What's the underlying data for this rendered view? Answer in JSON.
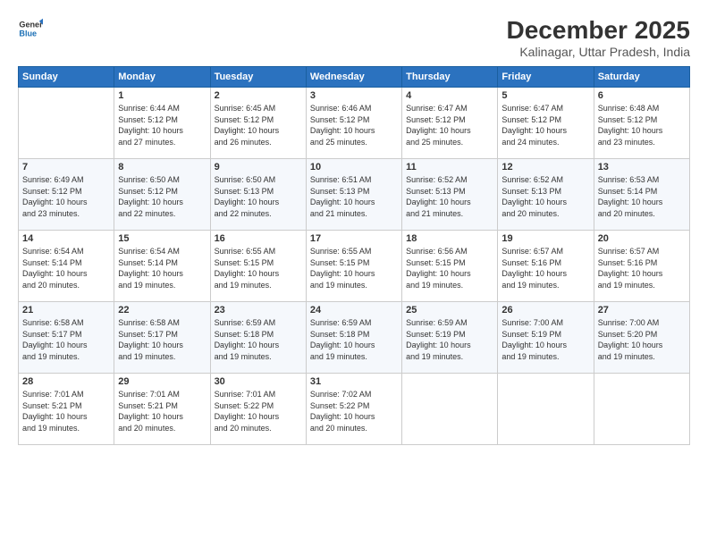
{
  "logo": {
    "line1": "General",
    "line2": "Blue"
  },
  "title": "December 2025",
  "location": "Kalinagar, Uttar Pradesh, India",
  "headers": [
    "Sunday",
    "Monday",
    "Tuesday",
    "Wednesday",
    "Thursday",
    "Friday",
    "Saturday"
  ],
  "weeks": [
    [
      {
        "day": "",
        "info": ""
      },
      {
        "day": "1",
        "info": "Sunrise: 6:44 AM\nSunset: 5:12 PM\nDaylight: 10 hours\nand 27 minutes."
      },
      {
        "day": "2",
        "info": "Sunrise: 6:45 AM\nSunset: 5:12 PM\nDaylight: 10 hours\nand 26 minutes."
      },
      {
        "day": "3",
        "info": "Sunrise: 6:46 AM\nSunset: 5:12 PM\nDaylight: 10 hours\nand 25 minutes."
      },
      {
        "day": "4",
        "info": "Sunrise: 6:47 AM\nSunset: 5:12 PM\nDaylight: 10 hours\nand 25 minutes."
      },
      {
        "day": "5",
        "info": "Sunrise: 6:47 AM\nSunset: 5:12 PM\nDaylight: 10 hours\nand 24 minutes."
      },
      {
        "day": "6",
        "info": "Sunrise: 6:48 AM\nSunset: 5:12 PM\nDaylight: 10 hours\nand 23 minutes."
      }
    ],
    [
      {
        "day": "7",
        "info": "Sunrise: 6:49 AM\nSunset: 5:12 PM\nDaylight: 10 hours\nand 23 minutes."
      },
      {
        "day": "8",
        "info": "Sunrise: 6:50 AM\nSunset: 5:12 PM\nDaylight: 10 hours\nand 22 minutes."
      },
      {
        "day": "9",
        "info": "Sunrise: 6:50 AM\nSunset: 5:13 PM\nDaylight: 10 hours\nand 22 minutes."
      },
      {
        "day": "10",
        "info": "Sunrise: 6:51 AM\nSunset: 5:13 PM\nDaylight: 10 hours\nand 21 minutes."
      },
      {
        "day": "11",
        "info": "Sunrise: 6:52 AM\nSunset: 5:13 PM\nDaylight: 10 hours\nand 21 minutes."
      },
      {
        "day": "12",
        "info": "Sunrise: 6:52 AM\nSunset: 5:13 PM\nDaylight: 10 hours\nand 20 minutes."
      },
      {
        "day": "13",
        "info": "Sunrise: 6:53 AM\nSunset: 5:14 PM\nDaylight: 10 hours\nand 20 minutes."
      }
    ],
    [
      {
        "day": "14",
        "info": "Sunrise: 6:54 AM\nSunset: 5:14 PM\nDaylight: 10 hours\nand 20 minutes."
      },
      {
        "day": "15",
        "info": "Sunrise: 6:54 AM\nSunset: 5:14 PM\nDaylight: 10 hours\nand 19 minutes."
      },
      {
        "day": "16",
        "info": "Sunrise: 6:55 AM\nSunset: 5:15 PM\nDaylight: 10 hours\nand 19 minutes."
      },
      {
        "day": "17",
        "info": "Sunrise: 6:55 AM\nSunset: 5:15 PM\nDaylight: 10 hours\nand 19 minutes."
      },
      {
        "day": "18",
        "info": "Sunrise: 6:56 AM\nSunset: 5:15 PM\nDaylight: 10 hours\nand 19 minutes."
      },
      {
        "day": "19",
        "info": "Sunrise: 6:57 AM\nSunset: 5:16 PM\nDaylight: 10 hours\nand 19 minutes."
      },
      {
        "day": "20",
        "info": "Sunrise: 6:57 AM\nSunset: 5:16 PM\nDaylight: 10 hours\nand 19 minutes."
      }
    ],
    [
      {
        "day": "21",
        "info": "Sunrise: 6:58 AM\nSunset: 5:17 PM\nDaylight: 10 hours\nand 19 minutes."
      },
      {
        "day": "22",
        "info": "Sunrise: 6:58 AM\nSunset: 5:17 PM\nDaylight: 10 hours\nand 19 minutes."
      },
      {
        "day": "23",
        "info": "Sunrise: 6:59 AM\nSunset: 5:18 PM\nDaylight: 10 hours\nand 19 minutes."
      },
      {
        "day": "24",
        "info": "Sunrise: 6:59 AM\nSunset: 5:18 PM\nDaylight: 10 hours\nand 19 minutes."
      },
      {
        "day": "25",
        "info": "Sunrise: 6:59 AM\nSunset: 5:19 PM\nDaylight: 10 hours\nand 19 minutes."
      },
      {
        "day": "26",
        "info": "Sunrise: 7:00 AM\nSunset: 5:19 PM\nDaylight: 10 hours\nand 19 minutes."
      },
      {
        "day": "27",
        "info": "Sunrise: 7:00 AM\nSunset: 5:20 PM\nDaylight: 10 hours\nand 19 minutes."
      }
    ],
    [
      {
        "day": "28",
        "info": "Sunrise: 7:01 AM\nSunset: 5:21 PM\nDaylight: 10 hours\nand 19 minutes."
      },
      {
        "day": "29",
        "info": "Sunrise: 7:01 AM\nSunset: 5:21 PM\nDaylight: 10 hours\nand 20 minutes."
      },
      {
        "day": "30",
        "info": "Sunrise: 7:01 AM\nSunset: 5:22 PM\nDaylight: 10 hours\nand 20 minutes."
      },
      {
        "day": "31",
        "info": "Sunrise: 7:02 AM\nSunset: 5:22 PM\nDaylight: 10 hours\nand 20 minutes."
      },
      {
        "day": "",
        "info": ""
      },
      {
        "day": "",
        "info": ""
      },
      {
        "day": "",
        "info": ""
      }
    ]
  ]
}
